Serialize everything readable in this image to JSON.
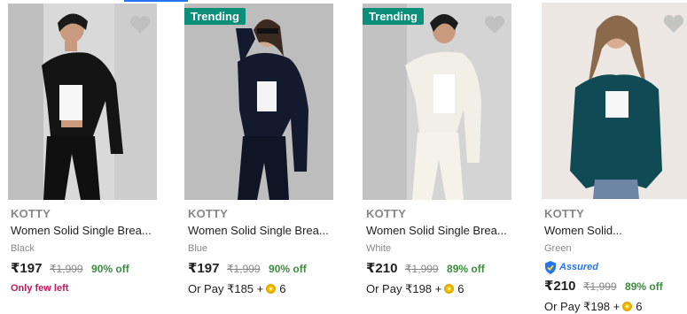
{
  "products": [
    {
      "brand": "KOTTY",
      "title": "Women Solid Single Brea...",
      "color": "Black",
      "price": "₹197",
      "mrp": "₹1,999",
      "discount": "90% off",
      "stock_note": "Only few left",
      "trending": "",
      "pay_text": "",
      "coin_count": "",
      "assured": ""
    },
    {
      "brand": "KOTTY",
      "title": "Women Solid Single Brea...",
      "color": "Blue",
      "price": "₹197",
      "mrp": "₹1,999",
      "discount": "90% off",
      "stock_note": "",
      "trending": "Trending",
      "pay_text": "Or Pay ₹185 +",
      "coin_count": "6",
      "assured": ""
    },
    {
      "brand": "KOTTY",
      "title": "Women Solid Single Brea...",
      "color": "White",
      "price": "₹210",
      "mrp": "₹1,999",
      "discount": "89% off",
      "stock_note": "",
      "trending": "Trending",
      "pay_text": "Or Pay ₹198 +",
      "coin_count": "6",
      "assured": ""
    },
    {
      "brand": "KOTTY",
      "title": "Women Solid...",
      "color": "Green",
      "price": "₹210",
      "mrp": "₹1,999",
      "discount": "89% off",
      "stock_note": "",
      "trending": "",
      "pay_text": "Or Pay ₹198 +",
      "coin_count": "6",
      "assured": "Assured"
    }
  ],
  "colors": {
    "trending_badge": "#0b8f7a",
    "discount": "#388e3c",
    "few_left": "#c2185b",
    "assured": "#2874f0",
    "heart": "#bdbdbd"
  },
  "icons": {
    "wishlist": "heart-icon",
    "coin": "supercoin-icon",
    "assured": "assured-shield-icon"
  }
}
